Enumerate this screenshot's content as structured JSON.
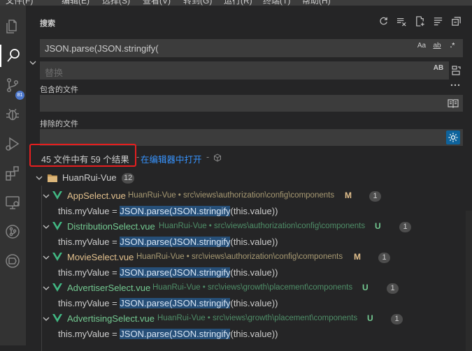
{
  "menu": [
    "文件(F)",
    "编辑(E)",
    "选择(S)",
    "查看(V)",
    "转到(G)",
    "运行(R)",
    "终端(T)",
    "帮助(H)"
  ],
  "activity_bar": {
    "items": [
      "files-icon",
      "search-icon",
      "source-control-icon",
      "debug-icon",
      "run-icon",
      "extensions-icon",
      "remote-explorer-icon",
      "git-graph-icon",
      "timeline-icon"
    ],
    "scm_badge": "81"
  },
  "search": {
    "title": "搜索",
    "query": "JSON.parse(JSON.stringify(",
    "query_options": [
      "Aa",
      "ab",
      ".*"
    ],
    "replace_placeholder": "替换",
    "replace_option": "AB",
    "include_label": "包含的文件",
    "exclude_label": "排除的文件",
    "summary": "45 文件中有 59 个结果",
    "separator": "-",
    "open_in_editor": "在编辑器中打开",
    "colors": {
      "accent": "#3794ff",
      "highlight_box": "#e51f1f",
      "untracked": "#73c991",
      "modified": "#e2c08d"
    }
  },
  "results": {
    "folder": {
      "name": "HuanRui-Vue",
      "count": "12"
    },
    "files": [
      {
        "name": "AppSelect.vue",
        "desc": "HuanRui-Vue • src\\views\\authorization\\config\\components",
        "status": "M",
        "count": "1",
        "match_pre": "this.myValue = ",
        "match_hl": "JSON.parse(JSON.stringify",
        "match_post": "(this.value))"
      },
      {
        "name": "DistributionSelect.vue",
        "desc": "HuanRui-Vue • src\\views\\authorization\\config\\components",
        "status": "U",
        "count": "1",
        "match_pre": "this.myValue = ",
        "match_hl": "JSON.parse(JSON.stringify",
        "match_post": "(this.value))"
      },
      {
        "name": "MovieSelect.vue",
        "desc": "HuanRui-Vue • src\\views\\authorization\\config\\components",
        "status": "M",
        "count": "1",
        "match_pre": "this.myValue = ",
        "match_hl": "JSON.parse(JSON.stringify",
        "match_post": "(this.value))"
      },
      {
        "name": "AdvertiserSelect.vue",
        "desc": "HuanRui-Vue • src\\views\\growth\\placement\\components",
        "status": "U",
        "count": "1",
        "match_pre": "this.myValue = ",
        "match_hl": "JSON.parse(JSON.stringify",
        "match_post": "(this.value))"
      },
      {
        "name": "AdvertisingSelect.vue",
        "desc": "HuanRui-Vue • src\\views\\growth\\placement\\components",
        "status": "U",
        "count": "1",
        "match_pre": "this.myValue = ",
        "match_hl": "JSON.parse(JSON.stringify",
        "match_post": "(this.value))"
      }
    ]
  }
}
